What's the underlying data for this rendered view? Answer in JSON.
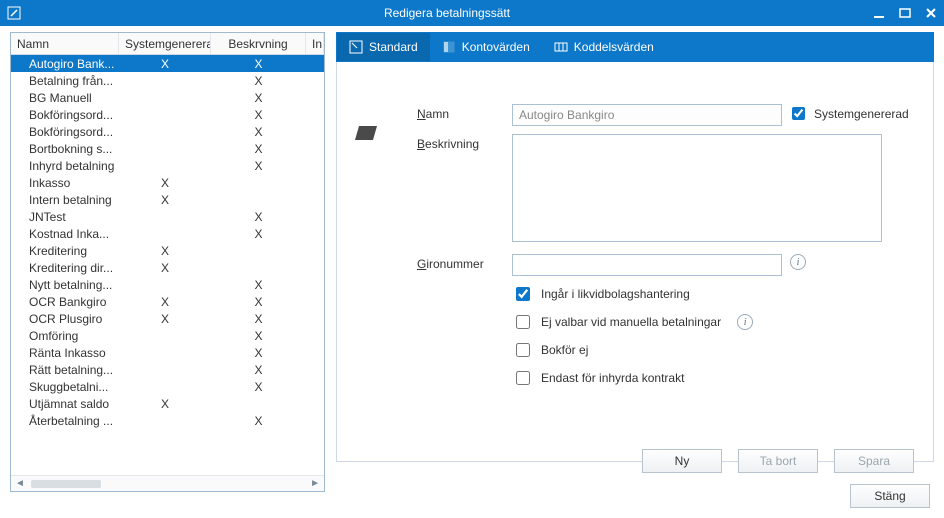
{
  "window": {
    "title": "Redigera betalningssätt"
  },
  "grid": {
    "headers": {
      "namn": "Namn",
      "sys": "Systemgenerad",
      "besk": "Beskrvning",
      "in": "In"
    },
    "headers_real": {
      "namn": "Namn",
      "sys": "Systemgenerad",
      "besk": "Beskrvning"
    },
    "header_namn": "Namn",
    "header_sys": "Systemgenererad",
    "header_besk": "Beskrvning",
    "header_in": "In",
    "rows": [
      {
        "namn": "Autogiro Bank...",
        "sys": "X",
        "besk": "X",
        "selected": true
      },
      {
        "namn": "Betalning från...",
        "sys": "",
        "besk": "X"
      },
      {
        "namn": "BG Manuell",
        "sys": "",
        "besk": "X"
      },
      {
        "namn": "Bokföringsord...",
        "sys": "",
        "besk": "X"
      },
      {
        "namn": "Bokföringsord...",
        "sys": "",
        "besk": "X"
      },
      {
        "namn": "Bortbokning s...",
        "sys": "",
        "besk": "X"
      },
      {
        "namn": "Inhyrd betalning",
        "sys": "",
        "besk": "X"
      },
      {
        "namn": "Inkasso",
        "sys": "X",
        "besk": ""
      },
      {
        "namn": "Intern betalning",
        "sys": "X",
        "besk": ""
      },
      {
        "namn": "JNTest",
        "sys": "",
        "besk": "X"
      },
      {
        "namn": "Kostnad Inka...",
        "sys": "",
        "besk": "X"
      },
      {
        "namn": "Kreditering",
        "sys": "X",
        "besk": ""
      },
      {
        "namn": "Kreditering dir...",
        "sys": "X",
        "besk": ""
      },
      {
        "namn": "Nytt betalning...",
        "sys": "",
        "besk": "X"
      },
      {
        "namn": "OCR Bankgiro",
        "sys": "X",
        "besk": "X"
      },
      {
        "namn": "OCR Plusgiro",
        "sys": "X",
        "besk": "X"
      },
      {
        "namn": "Omföring",
        "sys": "",
        "besk": "X"
      },
      {
        "namn": "Ränta Inkasso",
        "sys": "",
        "besk": "X"
      },
      {
        "namn": "Rätt betalning...",
        "sys": "",
        "besk": "X"
      },
      {
        "namn": "Skuggbetalni...",
        "sys": "",
        "besk": "X"
      },
      {
        "namn": "Utjämnat saldo",
        "sys": "X",
        "besk": ""
      },
      {
        "namn": "Återbetalning ...",
        "sys": "",
        "besk": "X"
      }
    ]
  },
  "tabs": {
    "standard": "Standard",
    "konto": "Kontovärden",
    "koddel": "Koddelsvärden"
  },
  "form": {
    "name_label": "Namn",
    "name_value": "Autogiro Bankgiro",
    "sysgen_label": "Systemgenererad",
    "besk_label": "Beskrivning",
    "besk_value": "",
    "giro_label": "Gironummer",
    "giro_value": "",
    "check_likvid": "Ingår i likvidbolagshantering",
    "check_ejvalbar": "Ej valbar vid manuella betalningar",
    "check_bokfor": "Bokför ej",
    "check_inhyrda": "Endast för inhyrda kontrakt"
  },
  "buttons": {
    "ny": "Ny",
    "tabort": "Ta bort",
    "spara": "Spara",
    "stang": "Stäng"
  }
}
